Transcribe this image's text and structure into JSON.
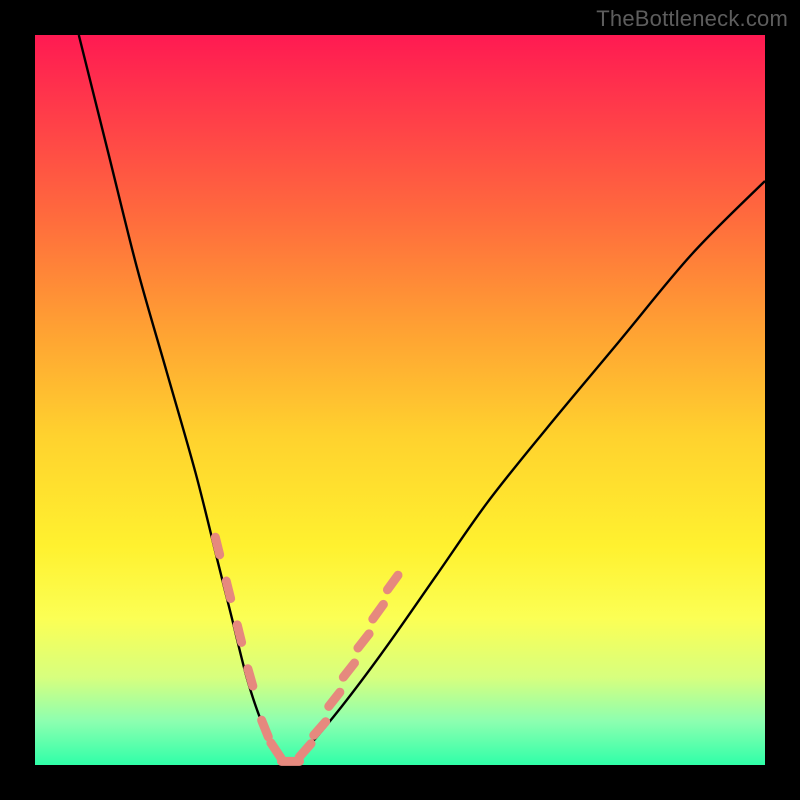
{
  "watermark": "TheBottleneck.com",
  "chart_data": {
    "type": "line",
    "title": "",
    "xlabel": "",
    "ylabel": "",
    "xlim": [
      0,
      100
    ],
    "ylim": [
      0,
      100
    ],
    "grid": false,
    "series": [
      {
        "name": "bottleneck-curve",
        "color": "#000000",
        "x": [
          6,
          10,
          14,
          18,
          22,
          25,
          27,
          29,
          31,
          33,
          35,
          37,
          42,
          48,
          55,
          62,
          70,
          80,
          90,
          100
        ],
        "values": [
          100,
          84,
          68,
          54,
          40,
          28,
          20,
          12,
          6,
          2,
          0,
          2,
          8,
          16,
          26,
          36,
          46,
          58,
          70,
          80
        ]
      }
    ],
    "markers": {
      "name": "highlight-dashes",
      "color": "#e6897e",
      "points": [
        {
          "x": 25,
          "y": 30
        },
        {
          "x": 26.5,
          "y": 24
        },
        {
          "x": 28,
          "y": 18
        },
        {
          "x": 29.5,
          "y": 12
        },
        {
          "x": 31.5,
          "y": 5
        },
        {
          "x": 33,
          "y": 2
        },
        {
          "x": 35,
          "y": 0.5
        },
        {
          "x": 37,
          "y": 2
        },
        {
          "x": 39,
          "y": 5
        },
        {
          "x": 41,
          "y": 9
        },
        {
          "x": 43,
          "y": 13
        },
        {
          "x": 45,
          "y": 17
        },
        {
          "x": 47,
          "y": 21
        },
        {
          "x": 49,
          "y": 25
        }
      ]
    },
    "gradient_stops": [
      {
        "pos": 0,
        "color": "#ff1a52"
      },
      {
        "pos": 25,
        "color": "#ff6b3d"
      },
      {
        "pos": 55,
        "color": "#ffd22e"
      },
      {
        "pos": 80,
        "color": "#fbff55"
      },
      {
        "pos": 100,
        "color": "#2fffa8"
      }
    ]
  }
}
